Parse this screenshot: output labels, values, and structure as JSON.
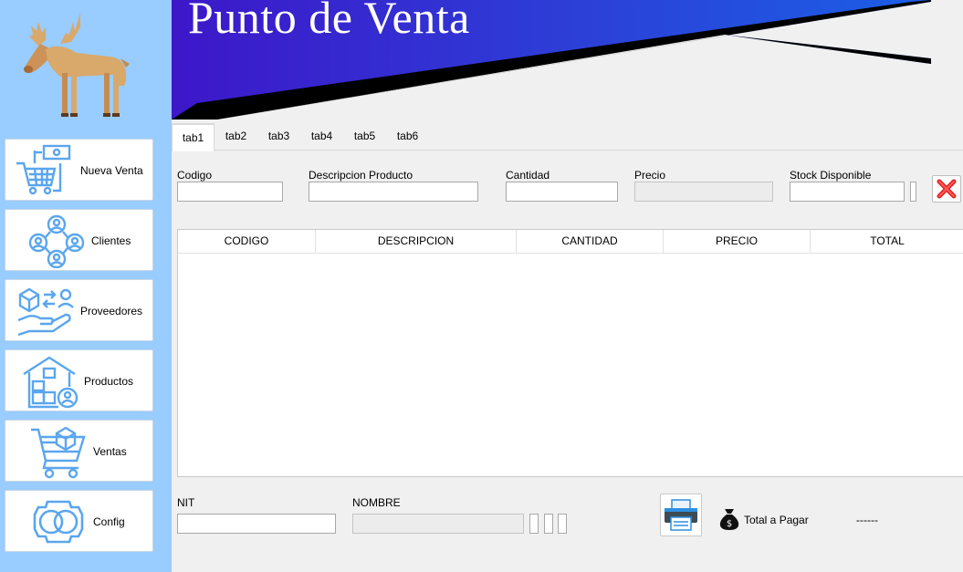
{
  "header": {
    "title": "Punto de Venta"
  },
  "sidebar": {
    "items": [
      {
        "label": "Nueva Venta"
      },
      {
        "label": "Clientes"
      },
      {
        "label": "Proveedores"
      },
      {
        "label": "Productos"
      },
      {
        "label": "Ventas"
      },
      {
        "label": "Config"
      }
    ]
  },
  "tabs": [
    "tab1",
    "tab2",
    "tab3",
    "tab4",
    "tab5",
    "tab6"
  ],
  "form": {
    "codigo_label": "Codigo",
    "descripcion_label": "Descripcion Producto",
    "cantidad_label": "Cantidad",
    "precio_label": "Precio",
    "stock_label": "Stock Disponible"
  },
  "table": {
    "columns": [
      "CODIGO",
      "DESCRIPCION",
      "CANTIDAD",
      "PRECIO",
      "TOTAL"
    ],
    "rows": []
  },
  "footer": {
    "nit_label": "NIT",
    "nombre_label": "NOMBRE",
    "total_label": "Total a Pagar",
    "total_value": "------"
  },
  "colors": {
    "sidebar": "#99ccff",
    "banner_start": "#3d17c9",
    "banner_end": "#1b5fe6",
    "icon": "#5aa6ee"
  }
}
